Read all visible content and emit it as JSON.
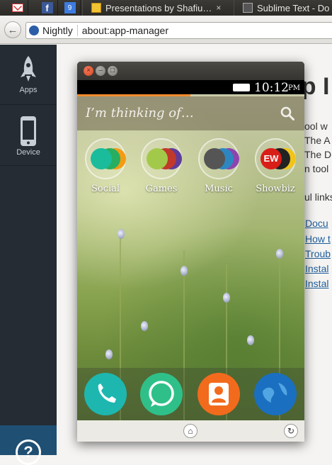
{
  "tabs": [
    {
      "type": "pinned",
      "icon": "gmail-icon",
      "badge": "M"
    },
    {
      "type": "pinned",
      "icon": "facebook-icon",
      "badge": "f"
    },
    {
      "type": "pinned",
      "icon": "google-plus-icon",
      "badge": "9"
    },
    {
      "type": "normal",
      "icon": "slides-icon",
      "title": "Presentations by Shafiu…"
    },
    {
      "type": "normal",
      "icon": "sublime-icon",
      "title": "Sublime Text - Do"
    }
  ],
  "tab_close_glyph": "×",
  "navbar": {
    "identity_label": "Nightly",
    "url": "about:app-manager"
  },
  "sidebar": {
    "items": [
      {
        "label": "Apps",
        "icon": "rocket-icon"
      },
      {
        "label": "Device",
        "icon": "phone-icon"
      }
    ],
    "help_glyph": "?"
  },
  "page": {
    "heading_fragment": "op I",
    "intro_lines": [
      "ool w",
      "The A",
      "The D",
      "n tool"
    ],
    "links_heading_fragment": "ul links",
    "links": [
      "Docu",
      "How t",
      "Troub",
      "Instal",
      "Instal"
    ]
  },
  "simulator": {
    "window_buttons": {
      "close": "×",
      "minimize": "–",
      "maximize": "□"
    },
    "clock": "10:12",
    "ampm": "PM",
    "search_placeholder": "I’m thinking of…",
    "collections": [
      {
        "label": "Social",
        "colors": [
          "#1abc9c",
          "#27ae60",
          "#f39c12"
        ]
      },
      {
        "label": "Games",
        "colors": [
          "#a3c94b",
          "#c0392b",
          "#5e3c99"
        ]
      },
      {
        "label": "Music",
        "colors": [
          "#555555",
          "#2e86c1",
          "#8e44ad"
        ]
      },
      {
        "label": "Showbiz",
        "colors": [
          "#d91e18",
          "#222222",
          "#f0c419"
        ],
        "badge": "EW"
      }
    ],
    "dock_apps": [
      {
        "name": "phone",
        "color": "#1db7b0"
      },
      {
        "name": "messages",
        "color": "#2fc08a"
      },
      {
        "name": "contacts",
        "color": "#f26b1d"
      },
      {
        "name": "browser",
        "color": "#1a6fc0"
      }
    ],
    "softkeys": {
      "home": "⌂",
      "rotate": "↻"
    },
    "colors": {
      "progress": "#f58b2c",
      "status_bar": "#000000"
    }
  }
}
